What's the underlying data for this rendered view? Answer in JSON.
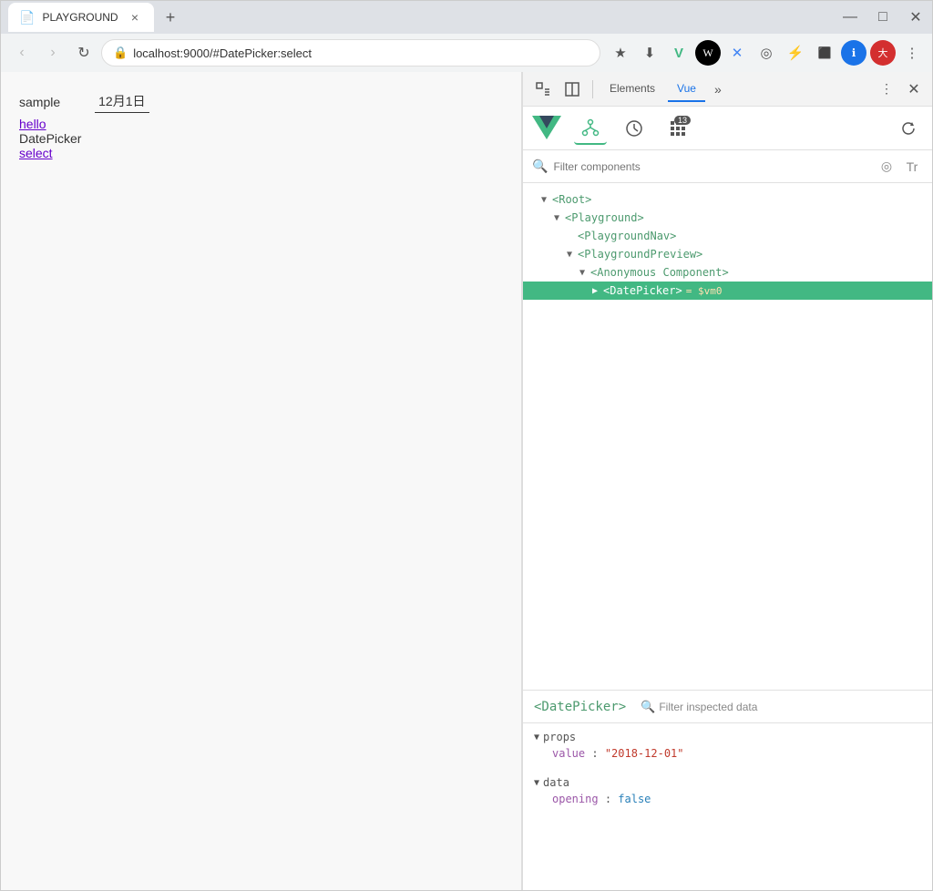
{
  "browser": {
    "tab": {
      "icon": "📄",
      "title": "PLAYGROUND",
      "close_label": "×"
    },
    "new_tab_label": "+",
    "window_controls": {
      "minimize": "—",
      "maximize": "□",
      "close": "✕"
    },
    "nav": {
      "back_label": "‹",
      "forward_label": "›",
      "reload_label": "↻",
      "address": "localhost:9000/#DatePicker:select",
      "lock_icon": "🔒"
    },
    "bookmarks": [
      "★",
      "⬇",
      "V",
      "W",
      "✕",
      "◎",
      "⚡",
      "⬛",
      "ℹ",
      "👤"
    ],
    "more_label": "⋮"
  },
  "page": {
    "sample_text": "sample",
    "hello_text": "hello",
    "datepicker_text": "DatePicker",
    "select_text": "select",
    "date_display": "12月1日"
  },
  "devtools": {
    "topbar": {
      "inspect_icon": "↗",
      "dock_icon": "⊡",
      "tab_elements": "Elements",
      "tab_vue": "Vue",
      "tab_more": "»",
      "more_options": "⋮",
      "close_label": "✕"
    },
    "vue_toolbar": {
      "component_tree_label": "⚬",
      "history_label": "⊙",
      "vuex_label": "⣿",
      "refresh_label": "↺",
      "badge_count": "13"
    },
    "filter": {
      "placeholder": "Filter components",
      "target_icon": "◎",
      "text_icon": "Tr"
    },
    "tree": {
      "items": [
        {
          "indent": 0,
          "expanded": true,
          "name": "<Root>",
          "vm": ""
        },
        {
          "indent": 1,
          "expanded": true,
          "name": "<Playground>",
          "vm": ""
        },
        {
          "indent": 2,
          "expanded": false,
          "name": "<PlaygroundNav>",
          "vm": ""
        },
        {
          "indent": 2,
          "expanded": true,
          "name": "<PlaygroundPreview>",
          "vm": ""
        },
        {
          "indent": 3,
          "expanded": true,
          "name": "<Anonymous Component>",
          "vm": ""
        },
        {
          "indent": 4,
          "expanded": false,
          "name": "<DatePicker>",
          "vm": "= $vm0",
          "selected": true
        }
      ]
    },
    "inspector": {
      "component_name": "<DatePicker>",
      "filter_label": "Filter inspected data",
      "props": {
        "section_label": "props",
        "items": [
          {
            "key": "value",
            "colon": ":",
            "value": "\"2018-12-01\"",
            "type": "string"
          }
        ]
      },
      "data": {
        "section_label": "data",
        "items": [
          {
            "key": "opening",
            "colon": ":",
            "value": "false",
            "type": "bool"
          }
        ]
      }
    }
  }
}
